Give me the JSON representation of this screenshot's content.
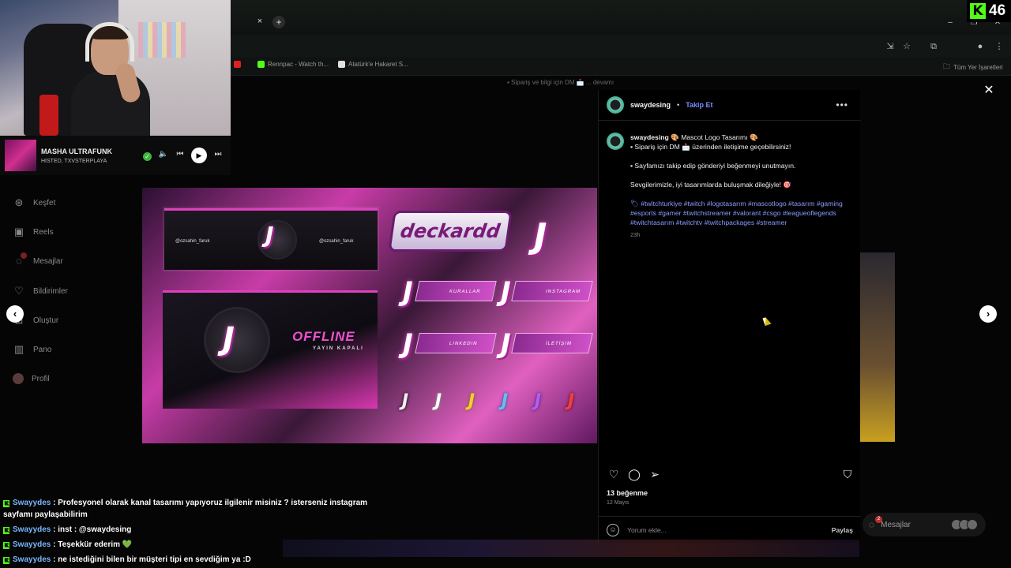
{
  "browser": {
    "new_tab": "+",
    "close_tab": "×",
    "bookmarks": [
      {
        "label": "Rennpac - Watch th...",
        "color": "#53fc18"
      },
      {
        "label": "Atatürk'e Hakaret S...",
        "color": "#e0e0e0"
      }
    ],
    "all_bookmarks": "Tüm Yer İşaretleri"
  },
  "kick": {
    "logo": "K",
    "viewer_count": "46"
  },
  "music": {
    "title": "MASHA ULTRAFUNK",
    "artist": "HISTED, TXVSTERPLAYA"
  },
  "sidebar": {
    "items": [
      {
        "label": "Keşfet",
        "icon": "compass-icon"
      },
      {
        "label": "Reels",
        "icon": "reels-icon"
      },
      {
        "label": "Mesajlar",
        "icon": "messenger-icon"
      },
      {
        "label": "Bildirimler",
        "icon": "heart-icon"
      },
      {
        "label": "Oluştur",
        "icon": "plus-icon"
      },
      {
        "label": "Pano",
        "icon": "dashboard-icon"
      },
      {
        "label": "Profil",
        "icon": "profile-icon"
      }
    ]
  },
  "background_caption": "▪ Sipariş ve bilgi için DM 📩 ... devamı",
  "post_image": {
    "brand": "deckardd",
    "offline_title_1": "OFF",
    "offline_title_2": "LINE",
    "offline_sub": "YAYIN KAPALI",
    "banner_left": "@ozsahin_faruk",
    "banner_right": "@ozsahin_faruk",
    "panels": [
      "KURALLAR",
      "INSTAGRAM",
      "LINKEDIN",
      "İLETİŞİM"
    ]
  },
  "post": {
    "username": "swaydesing",
    "follow": "Takip Et",
    "caption_user": "swaydesing",
    "caption_title": " 🎨 Mascot Logo Tasarımı 🎨",
    "line1": "▪ Sipariş için DM 📩 üzerinden iletişime geçebilirsiniz!",
    "line2": "▪ Sayfamızı takip edip gönderiyi beğenmeyi unutmayın.",
    "line3": "Sevgilerimizle, iyi tasarımlarda buluşmak dileğiyle! 🎯",
    "tags": "🏷 #twitchturkiye #twitch #logotasarım #mascotlogo #tasarım #gaming #esports #gamer #twitchstreamer #valorant #csgo #leagueoflegends #twitchtasarım #twitchtv #twitchpackages #streamer",
    "time": "23h",
    "likes": "13 beğenme",
    "date": "12 Mayıs",
    "comment_placeholder": "Yorum ekle...",
    "share": "Paylaş"
  },
  "messages_pill": {
    "label": "Mesajlar",
    "badge": "2"
  },
  "chat": [
    {
      "user": "Swayydes",
      "text": " : Profesyonel olarak kanal tasarımı yapıyoruz ilgilenir misiniz ? isterseniz instagram sayfamı paylaşabilirim"
    },
    {
      "user": "Swayydes",
      "text": " : inst : @swaydesing"
    },
    {
      "user": "Swayydes",
      "text": " : Teşekkür ederim "
    },
    {
      "user": "Swayydes",
      "text": " : ne istediğini bilen bir müşteri tipi en sevdiğim ya :D"
    }
  ],
  "chat_heart": "💚"
}
